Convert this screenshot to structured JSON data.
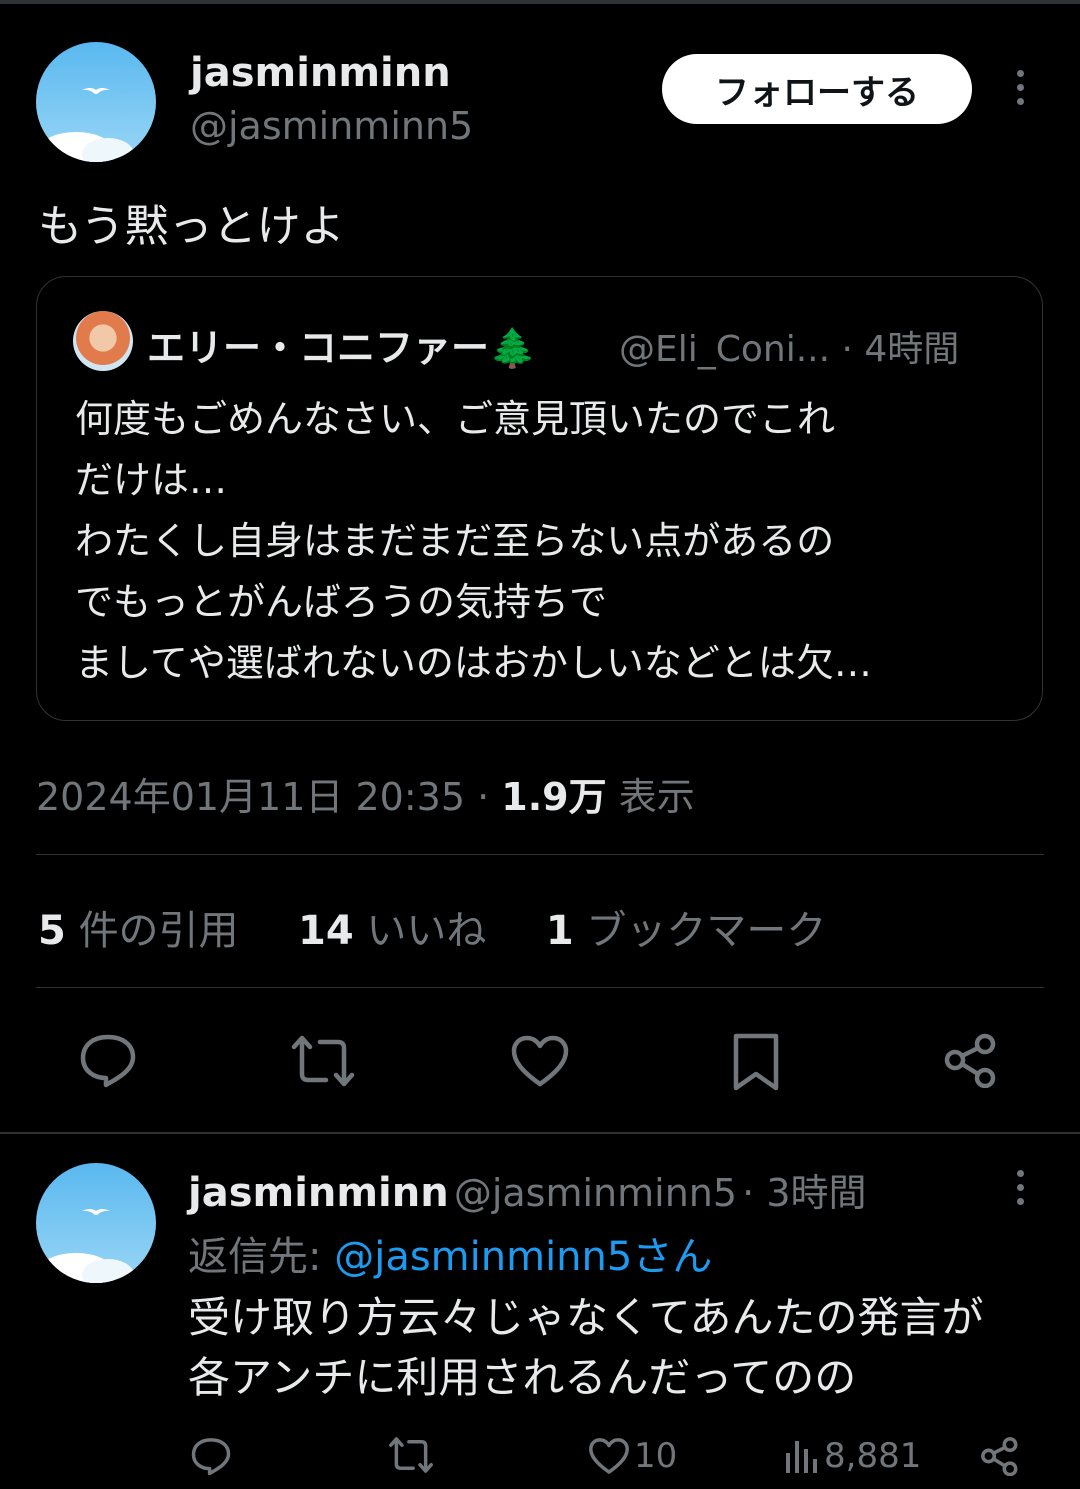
{
  "tweet": {
    "display_name": "jasminminn",
    "handle": "@jasminminn5",
    "follow_label": "フォローする",
    "text": "もう黙っとけよ",
    "timestamp": "2024年01月11日 20:35",
    "views_count": "1.9万",
    "views_label": "表示"
  },
  "quote": {
    "display_name": "エリー・コニファー🌲",
    "handle": "@Eli_Coni...",
    "time": "4時間",
    "lines": [
      "何度もごめんなさい、ご意見頂いたのでこれ",
      "だけは…",
      "わたくし自身はまだまだ至らない点があるの",
      "でもっとがんばろうの気持ちで",
      "ましてや選ばれないのはおかしいなどとは欠…"
    ]
  },
  "stats": {
    "quotes_count": "5",
    "quotes_label": "件の引用",
    "likes_count": "14",
    "likes_label": "いいね",
    "bookmarks_count": "1",
    "bookmarks_label": "ブックマーク"
  },
  "icons": [
    "reply-icon",
    "retweet-icon",
    "like-icon",
    "bookmark-icon",
    "share-icon",
    "more-icon",
    "views-icon"
  ],
  "reply": {
    "display_name": "jasminminn",
    "handle": "@jasminminn5",
    "time": "3時間",
    "reply_to_label": "返信先:",
    "reply_to_link": "@jasminminn5さん",
    "lines": [
      "受け取り方云々じゃなくてあんたの発言が",
      "各アンチに利用されるんだってのの"
    ],
    "likes": "10",
    "views": "8,881"
  },
  "colors": {
    "background": "#000000",
    "text": "#e7e9ea",
    "muted": "#71767b",
    "link": "#1d9bf0",
    "border": "#2f3336"
  }
}
